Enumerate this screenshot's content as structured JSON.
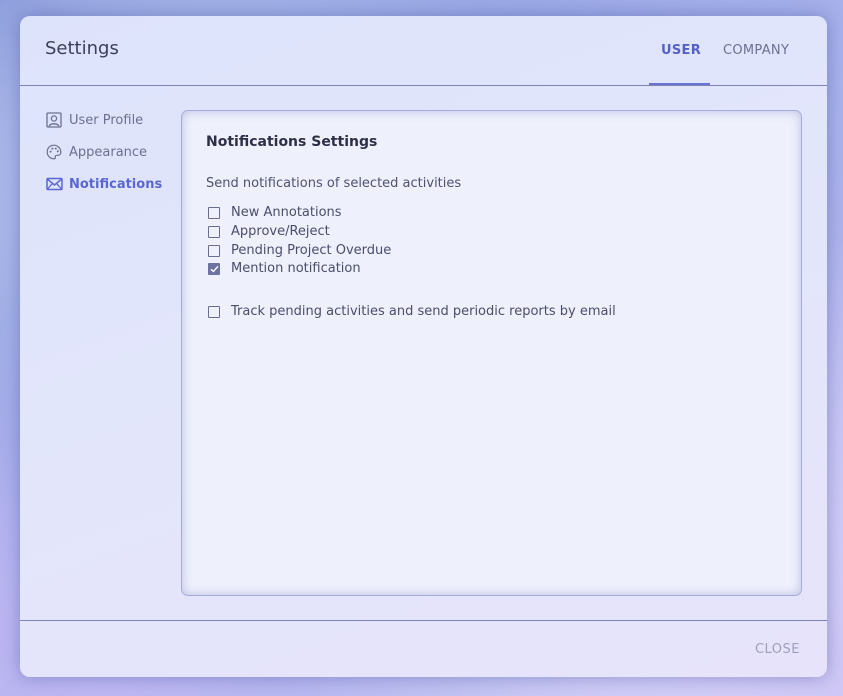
{
  "dialog": {
    "title": "Settings",
    "close_label": "CLOSE"
  },
  "tabs": [
    {
      "label": "USER",
      "active": true
    },
    {
      "label": "COMPANY",
      "active": false
    }
  ],
  "sidebar": {
    "items": [
      {
        "label": "User Profile",
        "icon": "user-profile-icon",
        "active": false
      },
      {
        "label": "Appearance",
        "icon": "palette-icon",
        "active": false
      },
      {
        "label": "Notifications",
        "icon": "envelope-icon",
        "active": true
      }
    ]
  },
  "panel": {
    "title": "Notifications Settings",
    "description": "Send notifications of selected activities",
    "options": [
      {
        "label": "New Annotations",
        "checked": false
      },
      {
        "label": "Approve/Reject",
        "checked": false
      },
      {
        "label": "Pending Project Overdue",
        "checked": false
      },
      {
        "label": "Mention notification",
        "checked": true
      }
    ],
    "track_option": {
      "label": "Track pending activities and send periodic reports by email",
      "checked": false
    }
  },
  "colors": {
    "accent": "#5561c7",
    "text": "#3b3f57",
    "divider": "#7c84b6"
  }
}
